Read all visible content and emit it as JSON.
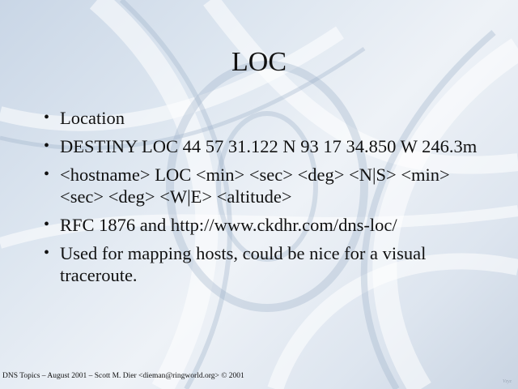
{
  "slide": {
    "title": "LOC",
    "bullets": [
      "Location",
      "DESTINY LOC 44 57 31.122 N 93 17 34.850 W 246.3m",
      "<hostname> LOC <min> <sec> <deg> <N|S> <min> <sec> <deg> <W|E> <altitude>",
      "RFC 1876 and http://www.ckdhr.com/dns-loc/",
      "Used for mapping hosts, could be nice for a visual traceroute."
    ],
    "bullet_symbol": "•",
    "footer": "DNS Topics – August 2001 – Scott M. Dier <dieman@ringworld.org> © 2001",
    "corner_mark": "Vzyz"
  },
  "colors": {
    "background": "#dde6f0",
    "text": "#111111"
  }
}
